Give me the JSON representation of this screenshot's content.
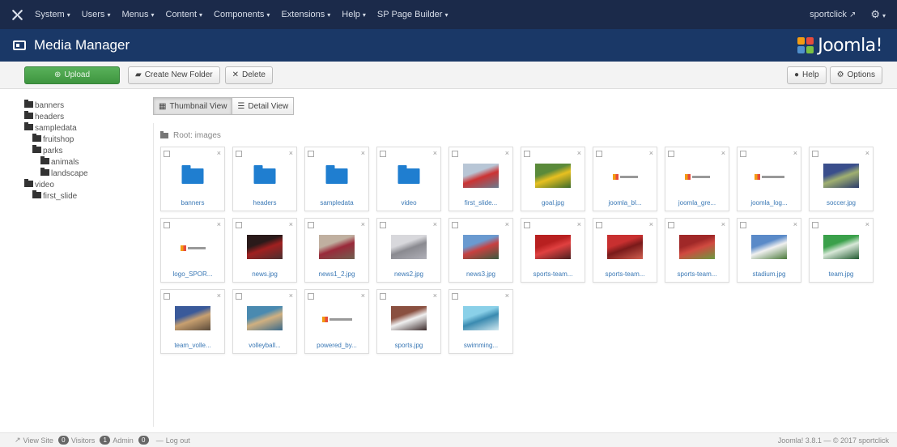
{
  "topbar": {
    "menu": [
      {
        "label": "System"
      },
      {
        "label": "Users"
      },
      {
        "label": "Menus"
      },
      {
        "label": "Content"
      },
      {
        "label": "Components"
      },
      {
        "label": "Extensions"
      },
      {
        "label": "Help"
      },
      {
        "label": "SP Page Builder"
      }
    ],
    "site_name": "sportclick",
    "caret": "▾",
    "external_icon": "↗",
    "gear_icon": "⚙"
  },
  "header": {
    "title": "Media Manager",
    "brand": "Joomla!"
  },
  "toolbar": {
    "upload": "Upload",
    "create_folder": "Create New Folder",
    "delete": "Delete",
    "help": "Help",
    "options": "Options"
  },
  "tree": [
    {
      "label": "banners",
      "level": 0
    },
    {
      "label": "headers",
      "level": 0
    },
    {
      "label": "sampledata",
      "level": 0
    },
    {
      "label": "fruitshop",
      "level": 1
    },
    {
      "label": "parks",
      "level": 1
    },
    {
      "label": "animals",
      "level": 2
    },
    {
      "label": "landscape",
      "level": 2
    },
    {
      "label": "video",
      "level": 0
    },
    {
      "label": "first_slide",
      "level": 1
    }
  ],
  "views": {
    "thumbnail": "Thumbnail View",
    "detail": "Detail View"
  },
  "breadcrumb": "Root: images",
  "items": [
    {
      "caption": "banners",
      "kind": "folder"
    },
    {
      "caption": "headers",
      "kind": "folder"
    },
    {
      "caption": "sampledata",
      "kind": "folder"
    },
    {
      "caption": "video",
      "kind": "folder"
    },
    {
      "caption": "first_slide...",
      "kind": "photo",
      "colors": [
        "#b8c6d6",
        "#c33",
        "#6a7c8e"
      ]
    },
    {
      "caption": "goal.jpg",
      "kind": "photo",
      "colors": [
        "#5a8a3a",
        "#e8c020",
        "#3b6a2a"
      ]
    },
    {
      "caption": "joomla_bl...",
      "kind": "logo"
    },
    {
      "caption": "joomla_gre...",
      "kind": "logo"
    },
    {
      "caption": "joomla_log...",
      "kind": "logo-big"
    },
    {
      "caption": "soccer.jpg",
      "kind": "photo",
      "colors": [
        "#3a4e8c",
        "#a0b070",
        "#2a3a6a"
      ]
    },
    {
      "caption": "logo_SPOR...",
      "kind": "logo"
    },
    {
      "caption": "news.jpg",
      "kind": "photo",
      "colors": [
        "#2a1a1a",
        "#a02020",
        "#4a3030"
      ]
    },
    {
      "caption": "news1_2.jpg",
      "kind": "photo",
      "colors": [
        "#c0b0a0",
        "#9a2a3a",
        "#706050"
      ]
    },
    {
      "caption": "news2.jpg",
      "kind": "photo",
      "colors": [
        "#d8d8dc",
        "#8a8a90",
        "#b0b0b8"
      ]
    },
    {
      "caption": "news3.jpg",
      "kind": "photo",
      "colors": [
        "#6a9ad0",
        "#c84040",
        "#3a5a40"
      ]
    },
    {
      "caption": "sports-team...",
      "kind": "photo",
      "colors": [
        "#b82020",
        "#e04040",
        "#4a2020"
      ]
    },
    {
      "caption": "sports-team...",
      "kind": "photo",
      "colors": [
        "#c83030",
        "#7a1a1a",
        "#d06050"
      ]
    },
    {
      "caption": "sports-team...",
      "kind": "photo",
      "colors": [
        "#a02828",
        "#d04a40",
        "#6a9a40"
      ]
    },
    {
      "caption": "stadium.jpg",
      "kind": "photo",
      "colors": [
        "#5a8ac8",
        "#f0f0f0",
        "#4a7a3a"
      ]
    },
    {
      "caption": "team.jpg",
      "kind": "photo",
      "colors": [
        "#3aa04a",
        "#d8e8d8",
        "#205a30"
      ]
    },
    {
      "caption": "team_volle...",
      "kind": "photo",
      "colors": [
        "#3a5a9a",
        "#c8a070",
        "#5a4a3a"
      ]
    },
    {
      "caption": "volleyball...",
      "kind": "photo",
      "colors": [
        "#4a8ab0",
        "#d0b080",
        "#3a6a8a"
      ]
    },
    {
      "caption": "powered_by...",
      "kind": "logo-big"
    },
    {
      "caption": "sports.jpg",
      "kind": "photo",
      "colors": [
        "#8a5040",
        "#f0f0f0",
        "#3a2a2a"
      ]
    },
    {
      "caption": "swimming...",
      "kind": "photo",
      "colors": [
        "#8ad0e8",
        "#3a8ab0",
        "#d0e8f0"
      ]
    }
  ],
  "footer": {
    "view_site": "View Site",
    "visitors_count": "0",
    "visitors": "Visitors",
    "admin_count": "1",
    "admin": "Admin",
    "messages_count": "0",
    "logout": "Log out",
    "version": "Joomla! 3.8.1 — © 2017 sportclick"
  },
  "colors": {
    "topbar": "#1b2a4a",
    "header": "#1a3867",
    "upload": "#4aa34b",
    "folder": "#1f7ed0",
    "caption": "#3a78b5"
  }
}
